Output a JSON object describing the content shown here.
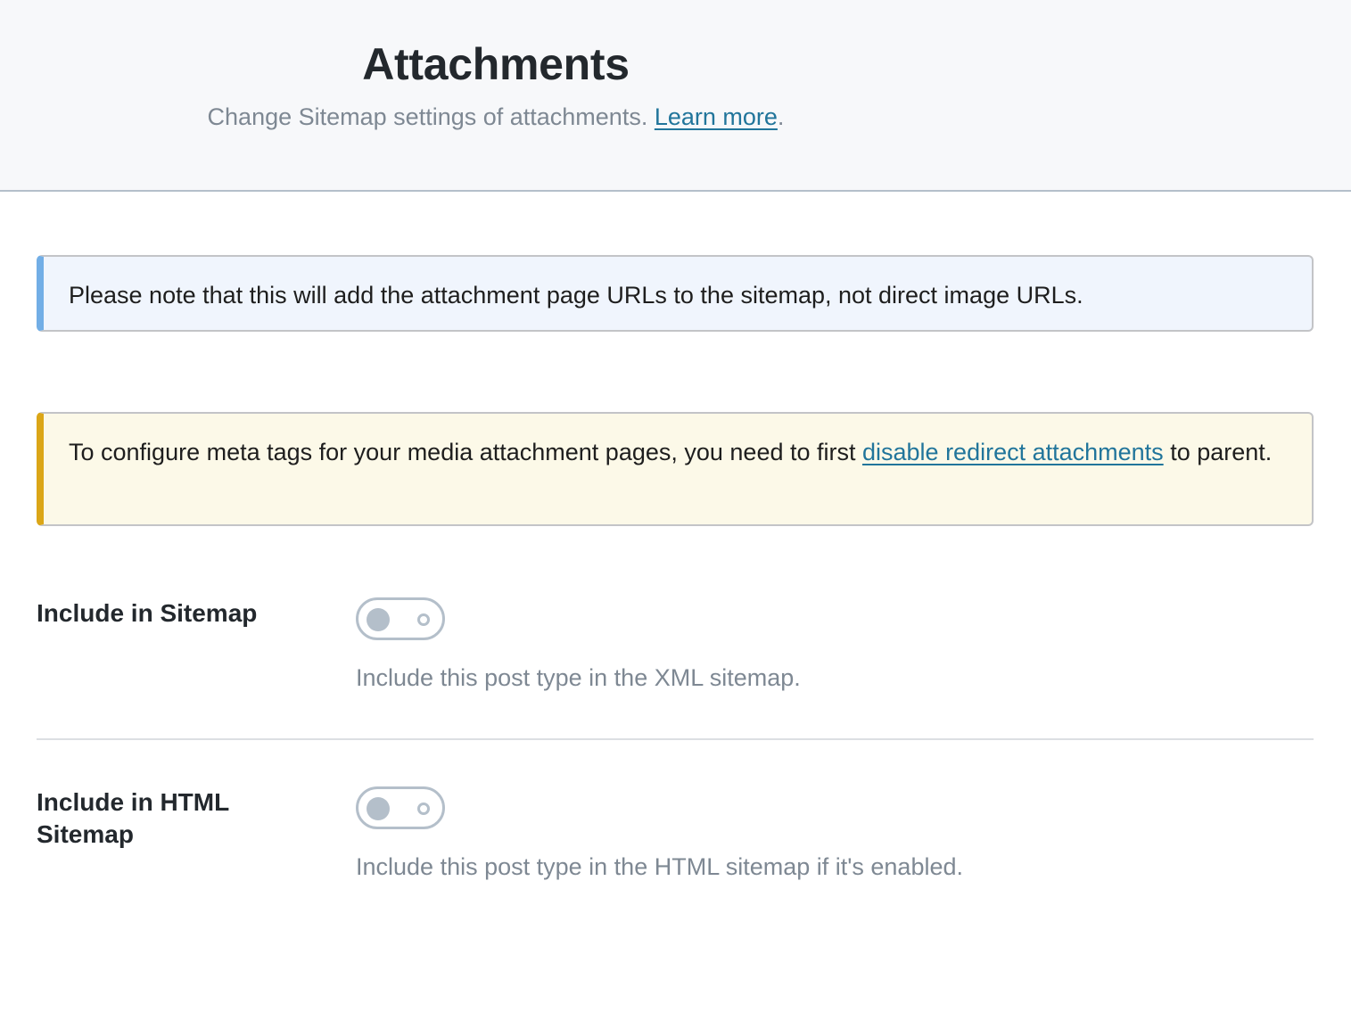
{
  "header": {
    "title": "Attachments",
    "subtitle": "Change Sitemap settings of attachments.",
    "learn_more": "Learn more",
    "subtitle_end": "."
  },
  "notices": {
    "info": {
      "text": "Please note that this will add the attachment page URLs to the sitemap, not direct image URLs.",
      "accent_color": "#72aee6"
    },
    "warning": {
      "text_before": "To configure meta tags for your media attachment pages, you need to first",
      "link": "disable redirect attachments",
      "text_after": "to parent.",
      "accent_color": "#dba617"
    }
  },
  "settings": [
    {
      "label": "Include in Sitemap",
      "description": "Include this post type in the XML sitemap.",
      "enabled": false
    },
    {
      "label": "Include in HTML Sitemap",
      "description": "Include this post type in the HTML sitemap if it's enabled.",
      "enabled": false
    }
  ],
  "colors": {
    "link": "#21759b",
    "muted_text": "#7e8893",
    "toggle_off": "#b4bfca"
  }
}
